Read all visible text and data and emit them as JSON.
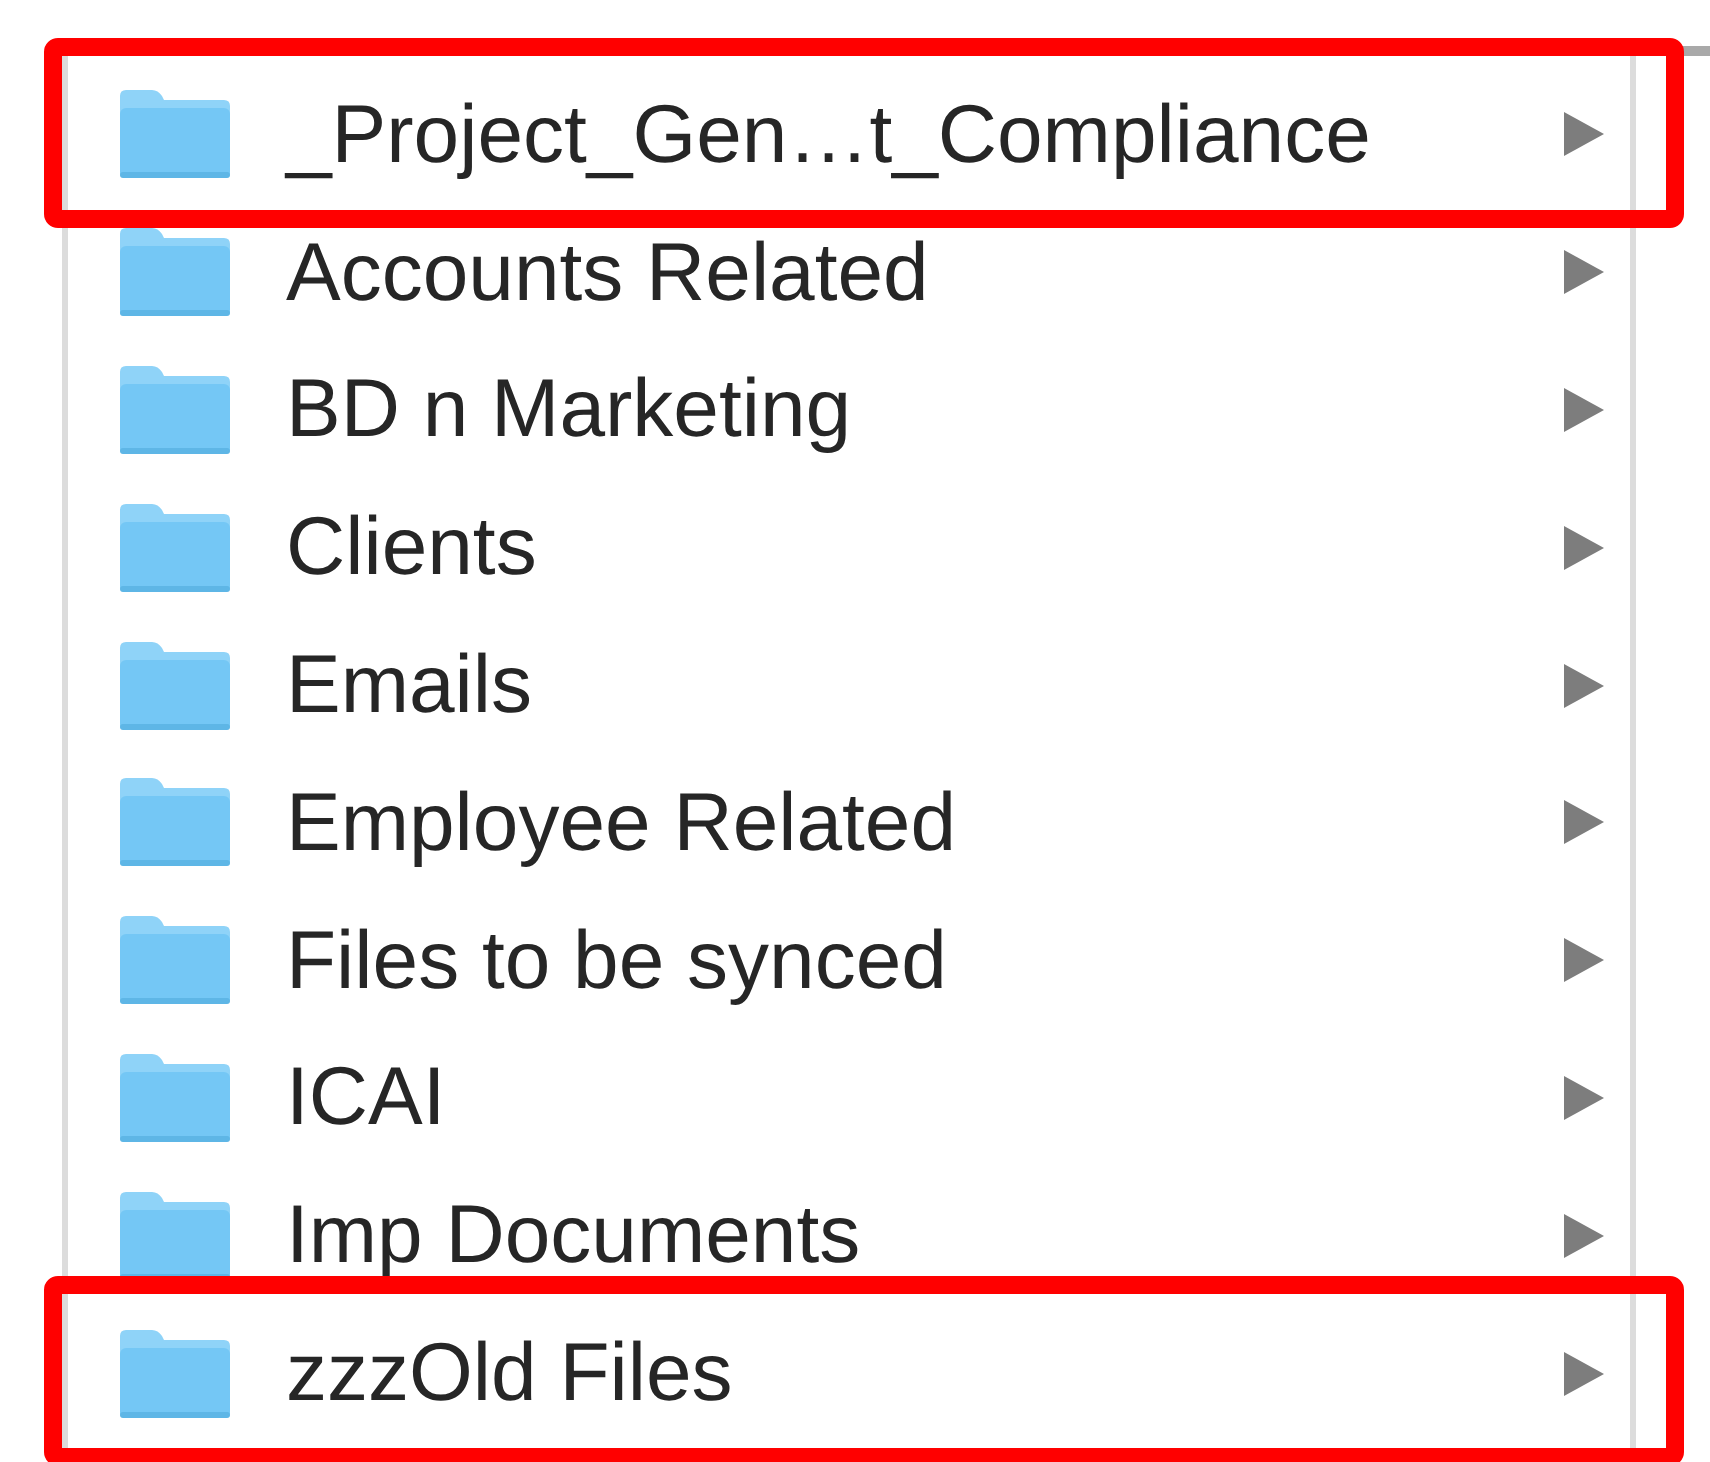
{
  "folders": [
    {
      "name": "_Project_Gen…t_Compliance",
      "highlighted": true
    },
    {
      "name": "Accounts Related",
      "highlighted": false
    },
    {
      "name": "BD n Marketing",
      "highlighted": false
    },
    {
      "name": "Clients",
      "highlighted": false
    },
    {
      "name": "Emails",
      "highlighted": false
    },
    {
      "name": "Employee Related",
      "highlighted": false
    },
    {
      "name": "Files to be synced",
      "highlighted": false
    },
    {
      "name": "ICAI",
      "highlighted": false
    },
    {
      "name": "Imp Documents",
      "highlighted": false
    },
    {
      "name": "zzzOld Files",
      "highlighted": true
    }
  ]
}
